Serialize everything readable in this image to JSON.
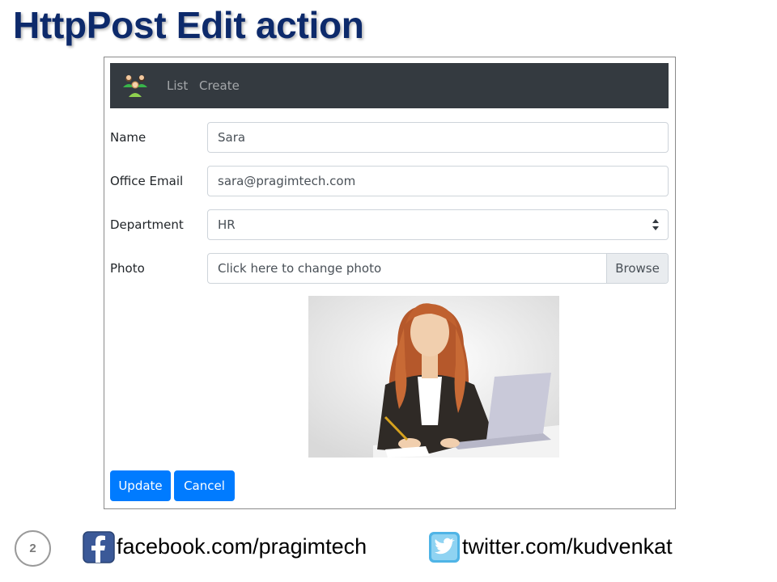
{
  "slide": {
    "title": "HttpPost Edit action",
    "page_number": "2"
  },
  "navbar": {
    "brand_icon": "people-group-icon",
    "links": [
      "List",
      "Create"
    ],
    "background": "#343a40"
  },
  "form": {
    "name": {
      "label": "Name",
      "value": "Sara"
    },
    "email": {
      "label": "Office Email",
      "value": "sara@pragimtech.com"
    },
    "department": {
      "label": "Department",
      "value": "HR"
    },
    "photo": {
      "label": "Photo",
      "value": "Click here to change photo",
      "browse_label": "Browse"
    }
  },
  "photo_preview": {
    "icon": "woman-at-laptop-illustration"
  },
  "buttons": {
    "update": "Update",
    "cancel": "Cancel",
    "color": "#007bff"
  },
  "footer": {
    "facebook": "facebook.com/pragimtech",
    "twitter": "twitter.com/kudvenkat"
  },
  "colors": {
    "title": "#0d2a6b"
  }
}
